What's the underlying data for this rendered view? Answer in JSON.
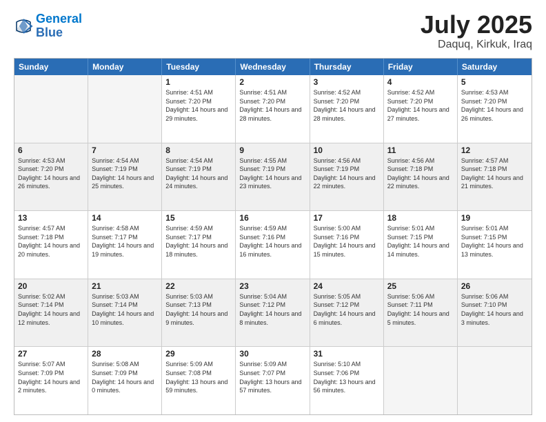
{
  "header": {
    "logo_line1": "General",
    "logo_line2": "Blue",
    "month": "July 2025",
    "location": "Daquq, Kirkuk, Iraq"
  },
  "weekdays": [
    "Sunday",
    "Monday",
    "Tuesday",
    "Wednesday",
    "Thursday",
    "Friday",
    "Saturday"
  ],
  "rows": [
    [
      {
        "day": "",
        "info": "",
        "empty": true
      },
      {
        "day": "",
        "info": "",
        "empty": true
      },
      {
        "day": "1",
        "info": "Sunrise: 4:51 AM\nSunset: 7:20 PM\nDaylight: 14 hours\nand 29 minutes."
      },
      {
        "day": "2",
        "info": "Sunrise: 4:51 AM\nSunset: 7:20 PM\nDaylight: 14 hours\nand 28 minutes."
      },
      {
        "day": "3",
        "info": "Sunrise: 4:52 AM\nSunset: 7:20 PM\nDaylight: 14 hours\nand 28 minutes."
      },
      {
        "day": "4",
        "info": "Sunrise: 4:52 AM\nSunset: 7:20 PM\nDaylight: 14 hours\nand 27 minutes."
      },
      {
        "day": "5",
        "info": "Sunrise: 4:53 AM\nSunset: 7:20 PM\nDaylight: 14 hours\nand 26 minutes."
      }
    ],
    [
      {
        "day": "6",
        "info": "Sunrise: 4:53 AM\nSunset: 7:20 PM\nDaylight: 14 hours\nand 26 minutes."
      },
      {
        "day": "7",
        "info": "Sunrise: 4:54 AM\nSunset: 7:19 PM\nDaylight: 14 hours\nand 25 minutes."
      },
      {
        "day": "8",
        "info": "Sunrise: 4:54 AM\nSunset: 7:19 PM\nDaylight: 14 hours\nand 24 minutes."
      },
      {
        "day": "9",
        "info": "Sunrise: 4:55 AM\nSunset: 7:19 PM\nDaylight: 14 hours\nand 23 minutes."
      },
      {
        "day": "10",
        "info": "Sunrise: 4:56 AM\nSunset: 7:19 PM\nDaylight: 14 hours\nand 22 minutes."
      },
      {
        "day": "11",
        "info": "Sunrise: 4:56 AM\nSunset: 7:18 PM\nDaylight: 14 hours\nand 22 minutes."
      },
      {
        "day": "12",
        "info": "Sunrise: 4:57 AM\nSunset: 7:18 PM\nDaylight: 14 hours\nand 21 minutes."
      }
    ],
    [
      {
        "day": "13",
        "info": "Sunrise: 4:57 AM\nSunset: 7:18 PM\nDaylight: 14 hours\nand 20 minutes."
      },
      {
        "day": "14",
        "info": "Sunrise: 4:58 AM\nSunset: 7:17 PM\nDaylight: 14 hours\nand 19 minutes."
      },
      {
        "day": "15",
        "info": "Sunrise: 4:59 AM\nSunset: 7:17 PM\nDaylight: 14 hours\nand 18 minutes."
      },
      {
        "day": "16",
        "info": "Sunrise: 4:59 AM\nSunset: 7:16 PM\nDaylight: 14 hours\nand 16 minutes."
      },
      {
        "day": "17",
        "info": "Sunrise: 5:00 AM\nSunset: 7:16 PM\nDaylight: 14 hours\nand 15 minutes."
      },
      {
        "day": "18",
        "info": "Sunrise: 5:01 AM\nSunset: 7:15 PM\nDaylight: 14 hours\nand 14 minutes."
      },
      {
        "day": "19",
        "info": "Sunrise: 5:01 AM\nSunset: 7:15 PM\nDaylight: 14 hours\nand 13 minutes."
      }
    ],
    [
      {
        "day": "20",
        "info": "Sunrise: 5:02 AM\nSunset: 7:14 PM\nDaylight: 14 hours\nand 12 minutes."
      },
      {
        "day": "21",
        "info": "Sunrise: 5:03 AM\nSunset: 7:14 PM\nDaylight: 14 hours\nand 10 minutes."
      },
      {
        "day": "22",
        "info": "Sunrise: 5:03 AM\nSunset: 7:13 PM\nDaylight: 14 hours\nand 9 minutes."
      },
      {
        "day": "23",
        "info": "Sunrise: 5:04 AM\nSunset: 7:12 PM\nDaylight: 14 hours\nand 8 minutes."
      },
      {
        "day": "24",
        "info": "Sunrise: 5:05 AM\nSunset: 7:12 PM\nDaylight: 14 hours\nand 6 minutes."
      },
      {
        "day": "25",
        "info": "Sunrise: 5:06 AM\nSunset: 7:11 PM\nDaylight: 14 hours\nand 5 minutes."
      },
      {
        "day": "26",
        "info": "Sunrise: 5:06 AM\nSunset: 7:10 PM\nDaylight: 14 hours\nand 3 minutes."
      }
    ],
    [
      {
        "day": "27",
        "info": "Sunrise: 5:07 AM\nSunset: 7:09 PM\nDaylight: 14 hours\nand 2 minutes."
      },
      {
        "day": "28",
        "info": "Sunrise: 5:08 AM\nSunset: 7:09 PM\nDaylight: 14 hours\nand 0 minutes."
      },
      {
        "day": "29",
        "info": "Sunrise: 5:09 AM\nSunset: 7:08 PM\nDaylight: 13 hours\nand 59 minutes."
      },
      {
        "day": "30",
        "info": "Sunrise: 5:09 AM\nSunset: 7:07 PM\nDaylight: 13 hours\nand 57 minutes."
      },
      {
        "day": "31",
        "info": "Sunrise: 5:10 AM\nSunset: 7:06 PM\nDaylight: 13 hours\nand 56 minutes."
      },
      {
        "day": "",
        "info": "",
        "empty": true
      },
      {
        "day": "",
        "info": "",
        "empty": true
      }
    ]
  ]
}
